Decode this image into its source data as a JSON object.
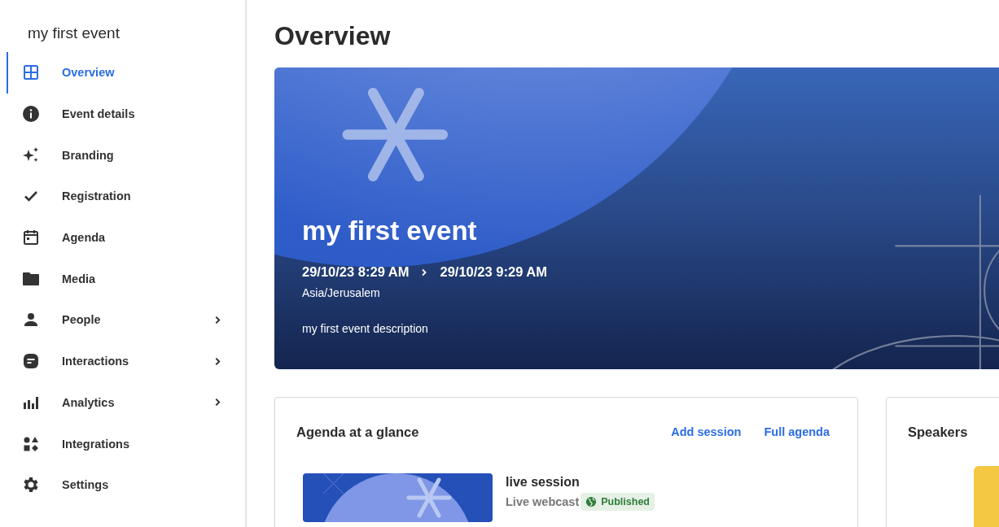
{
  "sidebar": {
    "event_name": "my first event",
    "items": [
      {
        "label": "Overview",
        "selected": true,
        "has_submenu": false
      },
      {
        "label": "Event details",
        "selected": false,
        "has_submenu": false
      },
      {
        "label": "Branding",
        "selected": false,
        "has_submenu": false
      },
      {
        "label": "Registration",
        "selected": false,
        "has_submenu": false
      },
      {
        "label": "Agenda",
        "selected": false,
        "has_submenu": false
      },
      {
        "label": "Media",
        "selected": false,
        "has_submenu": false
      },
      {
        "label": "People",
        "selected": false,
        "has_submenu": true
      },
      {
        "label": "Interactions",
        "selected": false,
        "has_submenu": true
      },
      {
        "label": "Analytics",
        "selected": false,
        "has_submenu": true
      },
      {
        "label": "Integrations",
        "selected": false,
        "has_submenu": false
      },
      {
        "label": "Settings",
        "selected": false,
        "has_submenu": false
      }
    ]
  },
  "page_title": "Overview",
  "hero": {
    "title": "my first event",
    "start": "29/10/23 8:29 AM",
    "end": "29/10/23 9:29 AM",
    "timezone": "Asia/Jerusalem",
    "description": "my first event description"
  },
  "agenda_card": {
    "title": "Agenda at a glance",
    "actions": [
      "Add session",
      "Full agenda"
    ],
    "sessions": [
      {
        "title": "live session",
        "type": "Live webcast",
        "status": "Published"
      }
    ]
  },
  "speakers_card": {
    "title": "Speakers"
  }
}
